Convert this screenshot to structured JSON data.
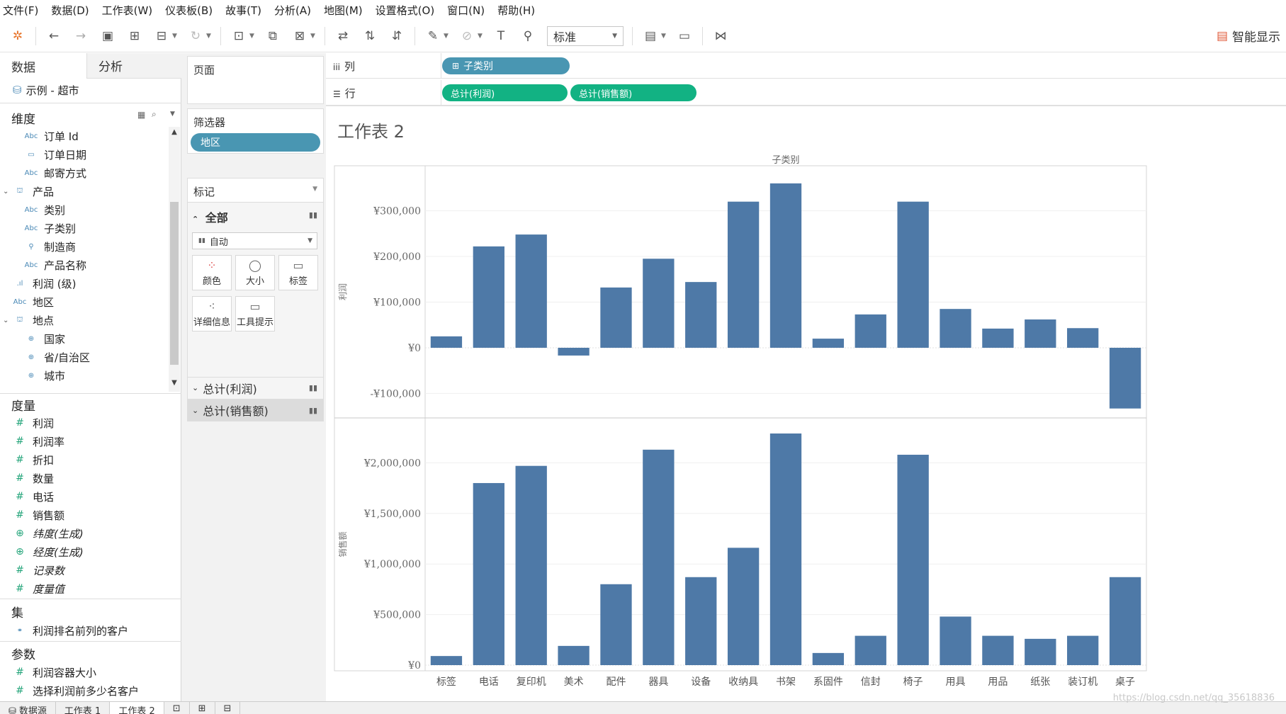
{
  "menu": [
    "文件(F)",
    "数据(D)",
    "工作表(W)",
    "仪表板(B)",
    "故事(T)",
    "分析(A)",
    "地图(M)",
    "设置格式(O)",
    "窗口(N)",
    "帮助(H)"
  ],
  "toolbar": {
    "fit_value": "标准",
    "show_me_label": "智能显示"
  },
  "data_pane": {
    "tab_data": "数据",
    "tab_analysis": "分析",
    "datasource": "示例 - 超市",
    "dimensions_title": "维度",
    "dimensions": [
      {
        "icon": "Abc",
        "label": "订单 Id"
      },
      {
        "icon": "▭",
        "label": "订单日期"
      },
      {
        "icon": "Abc",
        "label": "邮寄方式"
      },
      {
        "icon": "⛫",
        "label": "产品"
      },
      {
        "icon": "Abc",
        "label": "类别"
      },
      {
        "icon": "Abc",
        "label": "子类别"
      },
      {
        "icon": "⚲",
        "label": "制造商"
      },
      {
        "icon": "Abc",
        "label": "产品名称"
      },
      {
        "icon": ".ıl",
        "label": "利润 (级)"
      },
      {
        "icon": "Abc",
        "label": "地区"
      },
      {
        "icon": "⛫",
        "label": "地点"
      },
      {
        "icon": "⊕",
        "label": "国家"
      },
      {
        "icon": "⊕",
        "label": "省/自治区"
      },
      {
        "icon": "⊕",
        "label": "城市"
      }
    ],
    "measures_title": "度量",
    "measures": [
      {
        "label": "利润"
      },
      {
        "label": "利润率"
      },
      {
        "label": "折扣"
      },
      {
        "label": "数量"
      },
      {
        "label": "电话"
      },
      {
        "label": "销售额"
      },
      {
        "label": "纬度(生成)"
      },
      {
        "label": "经度(生成)"
      },
      {
        "label": "记录数"
      },
      {
        "label": "度量值"
      }
    ],
    "sets_title": "集",
    "sets": [
      {
        "label": "利润排名前列的客户"
      }
    ],
    "params_title": "参数",
    "params": [
      {
        "label": "利润容器大小"
      },
      {
        "label": "选择利润前多少名客户"
      }
    ]
  },
  "shelves": {
    "pages_title": "页面",
    "filters_title": "筛选器",
    "filter_pill": "地区",
    "marks_title": "标记",
    "marks_all": "全部",
    "mark_type": "自动",
    "mark_buttons": [
      "颜色",
      "大小",
      "标签",
      "详细信息",
      "工具提示"
    ],
    "mark_cards": [
      "总计(利润)",
      "总计(销售额)"
    ],
    "columns_label": "列",
    "rows_label": "行",
    "columns_pill": "子类别",
    "rows_pills": [
      "总计(利润)",
      "总计(销售额)"
    ]
  },
  "sheet": {
    "title": "工作表 2"
  },
  "tabs": [
    "数据源",
    "工作表 1",
    "工作表 2"
  ],
  "watermark": "https://blog.csdn.net/qq_35618836",
  "colors": {
    "bar": "#4e79a7"
  },
  "chart_data": {
    "type": "bar",
    "header": "子类别",
    "categories": [
      "标签",
      "电话",
      "复印机",
      "美术",
      "配件",
      "器具",
      "设备",
      "收纳具",
      "书架",
      "系固件",
      "信封",
      "椅子",
      "用具",
      "用品",
      "纸张",
      "装订机",
      "桌子"
    ],
    "series": [
      {
        "name": "利润",
        "values": [
          25000,
          222000,
          248000,
          -17000,
          132000,
          195000,
          144000,
          320000,
          360000,
          20000,
          73000,
          320000,
          85000,
          42000,
          62000,
          43000,
          -133000
        ],
        "ylim": [
          -135000,
          380000
        ],
        "ticks": [
          -100000,
          0,
          100000,
          200000,
          300000
        ],
        "tick_labels": [
          "-¥100,000",
          "¥0",
          "¥100,000",
          "¥200,000",
          "¥300,000"
        ]
      },
      {
        "name": "销售额",
        "values": [
          90000,
          1800000,
          1970000,
          190000,
          800000,
          2130000,
          870000,
          1160000,
          2290000,
          120000,
          290000,
          2080000,
          480000,
          290000,
          260000,
          290000,
          870000
        ],
        "ylim": [
          0,
          2360000
        ],
        "ticks": [
          0,
          500000,
          1000000,
          1500000,
          2000000
        ],
        "tick_labels": [
          "¥0",
          "¥500,000",
          "¥1,000,000",
          "¥1,500,000",
          "¥2,000,000"
        ]
      }
    ],
    "grid": true
  }
}
